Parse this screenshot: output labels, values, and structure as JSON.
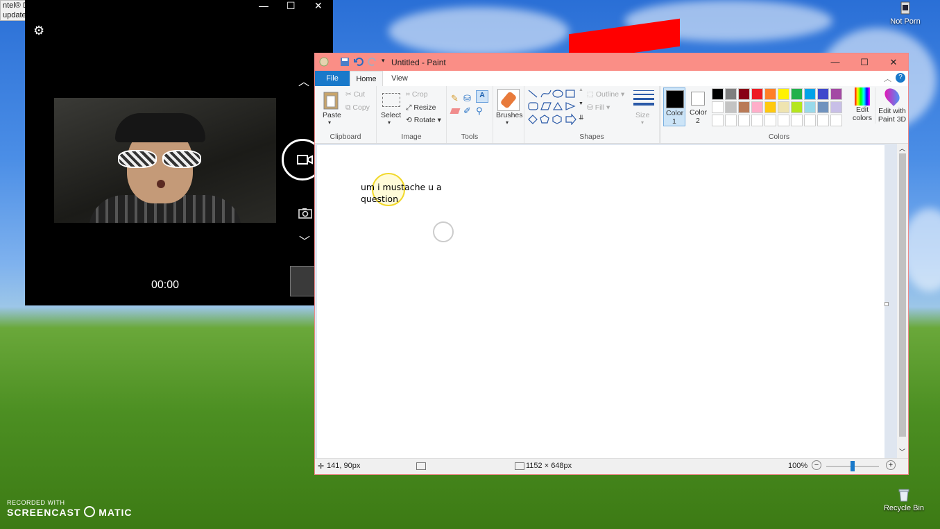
{
  "notification": {
    "line1": "ntel® Driver & Support Assistant",
    "line2": " updates available"
  },
  "camera": {
    "timer": "00:00"
  },
  "desktop": {
    "icon_top_right": "Not Porn",
    "recycle_bin": "Recycle Bin"
  },
  "watermark": {
    "line1": "RECORDED WITH",
    "line2": "SCREENCAST",
    "line3": "MATIC"
  },
  "paint": {
    "title": "Untitled - Paint",
    "tabs": {
      "file": "File",
      "home": "Home",
      "view": "View"
    },
    "clipboard": {
      "paste": "Paste",
      "cut": "Cut",
      "copy": "Copy",
      "label": "Clipboard"
    },
    "image": {
      "select": "Select",
      "crop": "Crop",
      "resize": "Resize",
      "rotate": "Rotate",
      "label": "Image"
    },
    "tools": {
      "label": "Tools"
    },
    "brushes": {
      "label": "Brushes"
    },
    "shapes": {
      "outline": "Outline",
      "fill": "Fill",
      "label": "Shapes"
    },
    "size": {
      "label": "Size"
    },
    "colors": {
      "color1": "Color",
      "color1_num": "1",
      "color2": "Color",
      "color2_num": "2",
      "label": "Colors",
      "edit": "Edit",
      "edit2": "colors",
      "paint3d": "Edit with",
      "paint3d2": "Paint 3D"
    },
    "palette_row1": [
      "#000000",
      "#7f7f7f",
      "#880015",
      "#ed1c24",
      "#ff7f27",
      "#fff200",
      "#22b14c",
      "#00a2e8",
      "#3f48cc",
      "#a349a4"
    ],
    "palette_row2": [
      "#ffffff",
      "#c3c3c3",
      "#b97a57",
      "#ffaec9",
      "#ffc90e",
      "#efe4b0",
      "#b5e61d",
      "#99d9ea",
      "#7092be",
      "#c8bfe7"
    ],
    "canvas_text": {
      "line1": "um i mustache u a",
      "line2": "question"
    },
    "status": {
      "cursor": "141, 90px",
      "dimensions": "1152 × 648px",
      "zoom": "100%"
    }
  }
}
